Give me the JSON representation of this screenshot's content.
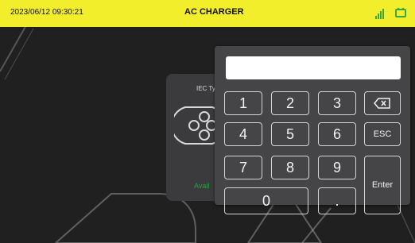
{
  "status_bar": {
    "datetime": "2023/06/12 09:30:21",
    "title": "AC CHARGER",
    "signal_icon": "signal-bars-icon",
    "plug_icon": "charger-plug-icon",
    "accent_color": "#f2ee2b"
  },
  "connector_card": {
    "label": "IEC Ty",
    "status": "Avail",
    "icon": "iec-type2-connector-icon"
  },
  "keypad": {
    "display_value": "",
    "keys": {
      "k1": "1",
      "k2": "2",
      "k3": "3",
      "k4": "4",
      "k5": "5",
      "k6": "6",
      "k7": "7",
      "k8": "8",
      "k9": "9",
      "k0": "0",
      "dot": ".",
      "esc": "ESC",
      "enter": "Enter"
    },
    "backspace_icon": "backspace-icon"
  }
}
